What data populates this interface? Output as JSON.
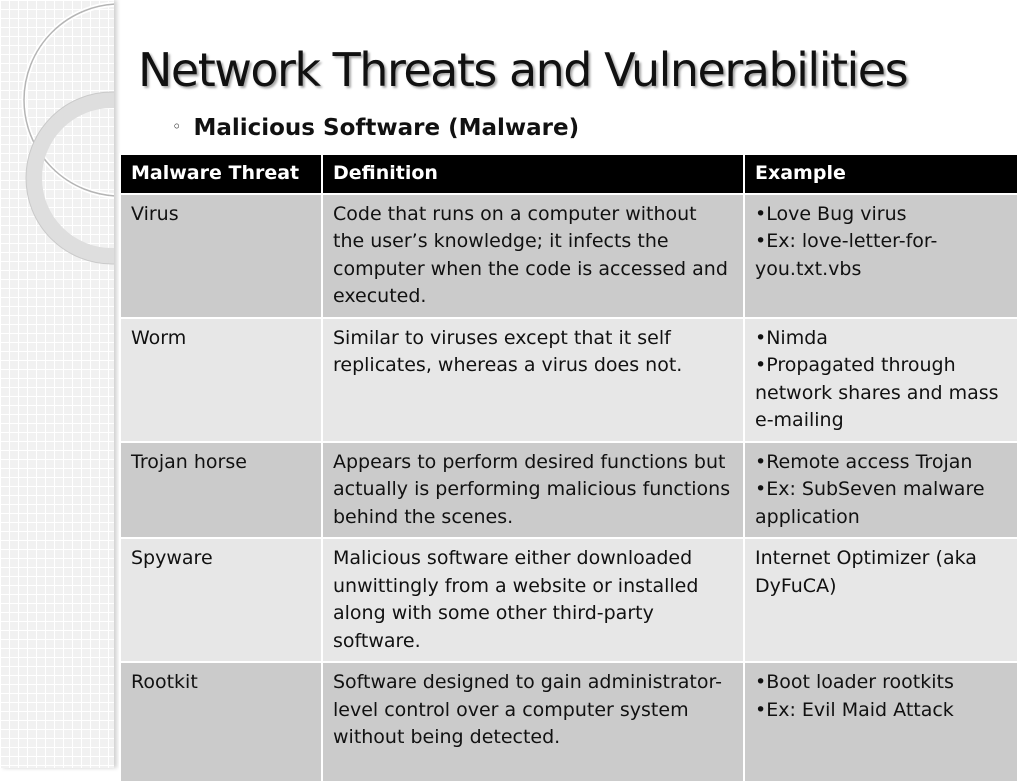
{
  "slide": {
    "title": "Network Threats and Vulnerabilities",
    "subtitle_bullet": "◦",
    "subtitle": "Malicious Software (Malware)"
  },
  "table": {
    "headers": [
      "Malware Threat",
      "Definition",
      "Example"
    ],
    "rows": [
      {
        "threat": "Virus",
        "definition": "Code that runs on a computer without the user’s knowledge; it infects the computer when the code is accessed and executed.",
        "examples": [
          "•Love Bug virus",
          "•Ex: love-letter-for-you.txt.vbs"
        ]
      },
      {
        "threat": "Worm",
        "definition": "Similar to viruses except that it self replicates, whereas a virus does not.",
        "examples": [
          "•Nimda",
          "•Propagated through network shares and mass e-mailing"
        ]
      },
      {
        "threat": "Trojan horse",
        "definition": "Appears to perform desired functions but actually is performing malicious functions behind the scenes.",
        "examples": [
          "•Remote access Trojan",
          "•Ex: SubSeven malware application"
        ]
      },
      {
        "threat": "Spyware",
        "definition": "Malicious software either downloaded unwittingly from a website or installed along with some other third-party software.",
        "examples": [
          "Internet Optimizer (aka DyFuCA)"
        ]
      },
      {
        "threat": "Rootkit",
        "definition": "Software designed to gain administrator-level control over a computer system without being detected.",
        "examples": [
          "•Boot loader rootkits",
          "•Ex: Evil Maid Attack"
        ]
      }
    ]
  },
  "colors": {
    "header_bg": "#000000",
    "row_dark": "#cbcbcb",
    "row_light": "#e7e7e7"
  }
}
